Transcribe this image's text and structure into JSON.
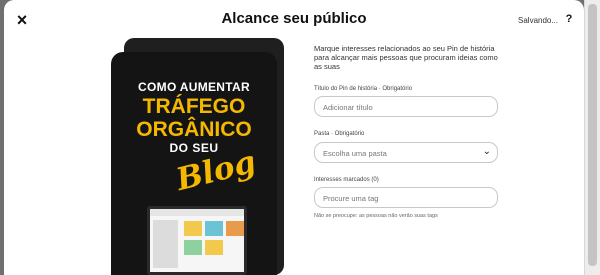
{
  "header": {
    "title": "Alcance seu público",
    "close_icon": "×",
    "saving_status": "Salvando...",
    "help_icon": "?"
  },
  "pin_preview": {
    "line1": "COMO AUMENTAR",
    "line2": "TRÁFEGO",
    "line3": "ORGÂNICO",
    "line4": "DO SEU",
    "line5": "Blog"
  },
  "form": {
    "description": "Marque interesses relacionados ao seu Pin de história para alcançar mais pessoas que procuram ideias como as suas",
    "title_label": "Título do Pin de história · Obrigatório",
    "title_placeholder": "Adicionar título",
    "board_label": "Pasta · Obrigatório",
    "board_placeholder": "Escolha uma pasta",
    "tags_label": "Interesses marcados (0)",
    "tags_placeholder": "Procure uma tag",
    "tags_hint": "Não se preocupe: as pessoas não verão suas tags"
  },
  "colors": {
    "accent_yellow": "#f5b800",
    "pin_background": "#141414"
  }
}
